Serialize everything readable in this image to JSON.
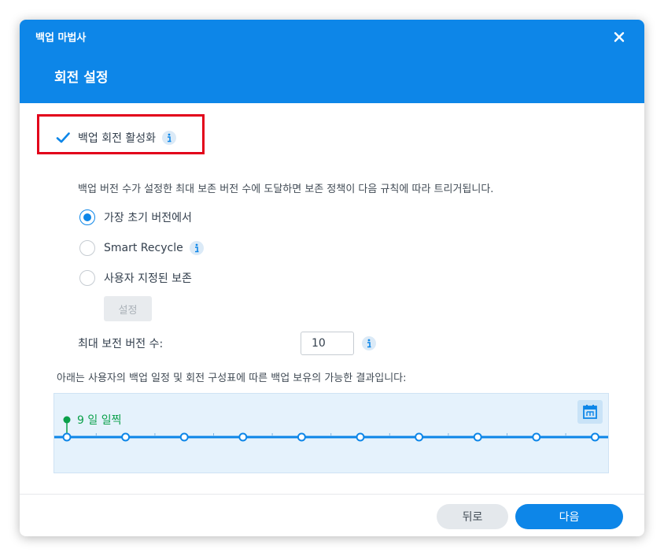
{
  "window": {
    "title": "백업 마법사"
  },
  "step": {
    "title": "회전 설정"
  },
  "rotation": {
    "enable_label": "백업 회전 활성화",
    "enabled": true,
    "description": "백업 버전 수가 설정한 최대 보존 버전 수에 도달하면 보존 정책이 다음 규칙에 따라 트리거됩니다.",
    "options": [
      {
        "label": "가장 초기 버전에서",
        "selected": true
      },
      {
        "label": "Smart Recycle",
        "selected": false
      },
      {
        "label": "사용자 지정된 보존",
        "selected": false
      }
    ],
    "settings_label": "설정",
    "max_versions_label": "최대 보전 버전 수:",
    "max_versions_value": "10"
  },
  "timeline": {
    "result_label": "아래는 사용자의 백업 일정 및 회전 구성표에 따른 백업 보유의 가능한 결과입니다:",
    "marker_label": "9 일 일찍",
    "version_count": 10
  },
  "footer": {
    "back_label": "뒤로",
    "next_label": "다음"
  },
  "colors": {
    "primary": "#0d86e8",
    "highlight_border": "#e2001a",
    "timeline_green": "#0aa04a",
    "timeline_bg": "#e5f2fc"
  },
  "icons": {
    "close": "close-icon",
    "info": "info-icon",
    "check": "checkmark-icon",
    "calendar": "calendar-icon"
  }
}
